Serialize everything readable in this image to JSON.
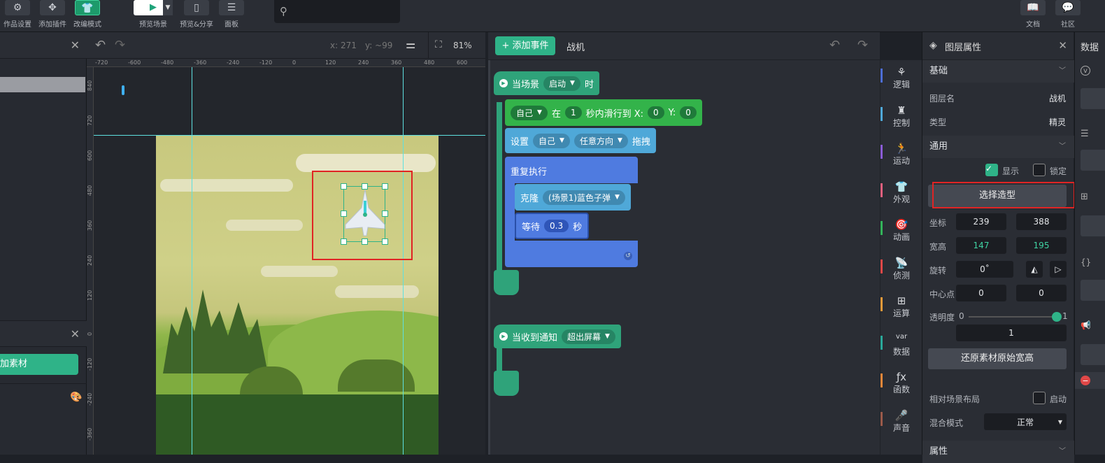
{
  "toolbar": {
    "work_settings": "作品设置",
    "add_plugin": "添加插件",
    "edit_mode": "改编模式",
    "preview_scene": "预览场景",
    "preview_share": "预览&分享",
    "panel": "面板",
    "docs": "文档",
    "community": "社区"
  },
  "stage": {
    "x_readout": "x: 271",
    "y_readout": "y: ~99",
    "zoom": "81%",
    "ruler_top": [
      "-720",
      "-600",
      "-480",
      "-360",
      "-240",
      "-120",
      "0",
      "120",
      "240",
      "360",
      "480",
      "600"
    ],
    "ruler_left": [
      "840",
      "720",
      "600",
      "480",
      "360",
      "240",
      "120",
      "0",
      "-120",
      "-240",
      "-360"
    ]
  },
  "left_panel": {
    "add_asset_btn": "加素材"
  },
  "code": {
    "add_event": "+ 添加事件",
    "sprite_name": "战机",
    "event1": {
      "prefix": "当场景",
      "dropdown": "启动",
      "suffix": "时"
    },
    "glide": {
      "target": "自己",
      "in": "在",
      "secs": "1",
      "label": "秒内滑行到 X:",
      "x": "0",
      "y_label": "Y:",
      "y": "0"
    },
    "drag": {
      "set": "设置",
      "target": "自己",
      "direction": "任意方向",
      "suffix": "拖拽"
    },
    "repeat": {
      "label": "重复执行"
    },
    "clone": {
      "label": "克隆",
      "target": "(场景1)蓝色子弹"
    },
    "wait": {
      "label": "等待",
      "value": "0.3",
      "unit": "秒"
    },
    "event2": {
      "prefix": "当收到通知",
      "dropdown": "超出屏幕"
    }
  },
  "categories": [
    {
      "label": "逻辑",
      "icon": "logic-icon",
      "color": "#4d6ed6"
    },
    {
      "label": "控制",
      "icon": "control-icon",
      "color": "#4fa8d8"
    },
    {
      "label": "运动",
      "icon": "motion-icon",
      "color": "#8a5cd6"
    },
    {
      "label": "外观",
      "icon": "appearance-icon",
      "color": "#e0607e"
    },
    {
      "label": "动画",
      "icon": "animation-icon",
      "color": "#33b35a"
    },
    {
      "label": "侦测",
      "icon": "sensing-icon",
      "color": "#e04848"
    },
    {
      "label": "运算",
      "icon": "operator-icon",
      "color": "#e89a3a"
    },
    {
      "label": "数据",
      "icon": "data-icon",
      "color": "#2aa89a"
    },
    {
      "label": "函数",
      "icon": "function-icon",
      "color": "#e8873a"
    },
    {
      "label": "声音",
      "icon": "sound-icon",
      "color": "#9a5a4a"
    }
  ],
  "props": {
    "title": "图层属性",
    "basic_section": "基础",
    "layer_name_label": "图层名",
    "layer_name_value": "战机",
    "type_label": "类型",
    "type_value": "精灵",
    "general_section": "通用",
    "show_label": "显示",
    "lock_label": "锁定",
    "choose_costume": "选择造型",
    "coord_label": "坐标",
    "coord_x": "239",
    "coord_y": "388",
    "size_label": "宽高",
    "width": "147",
    "height": "195",
    "rotation_label": "旋转",
    "rotation": "0˚",
    "center_label": "中心点",
    "center_x": "0",
    "center_y": "0",
    "opacity_label": "透明度",
    "opacity_min": "0",
    "opacity_max": "1",
    "opacity_value": "1",
    "opacity_level": 1,
    "restore_size": "还原素材原始宽高",
    "relative_layout_label": "相对场景布局",
    "relative_layout_toggle": "启动",
    "blend_label": "混合模式",
    "blend_value": "正常",
    "attributes_section": "属性"
  },
  "data_panel": {
    "title": "数据"
  },
  "colors": {
    "event_green": "#2fa37a",
    "motion_green": "#33b34a",
    "control_blue": "#4a9ad6",
    "loop_blue": "#4f7be0",
    "accent": "#2fb388",
    "highlight_red": "#e02424"
  }
}
